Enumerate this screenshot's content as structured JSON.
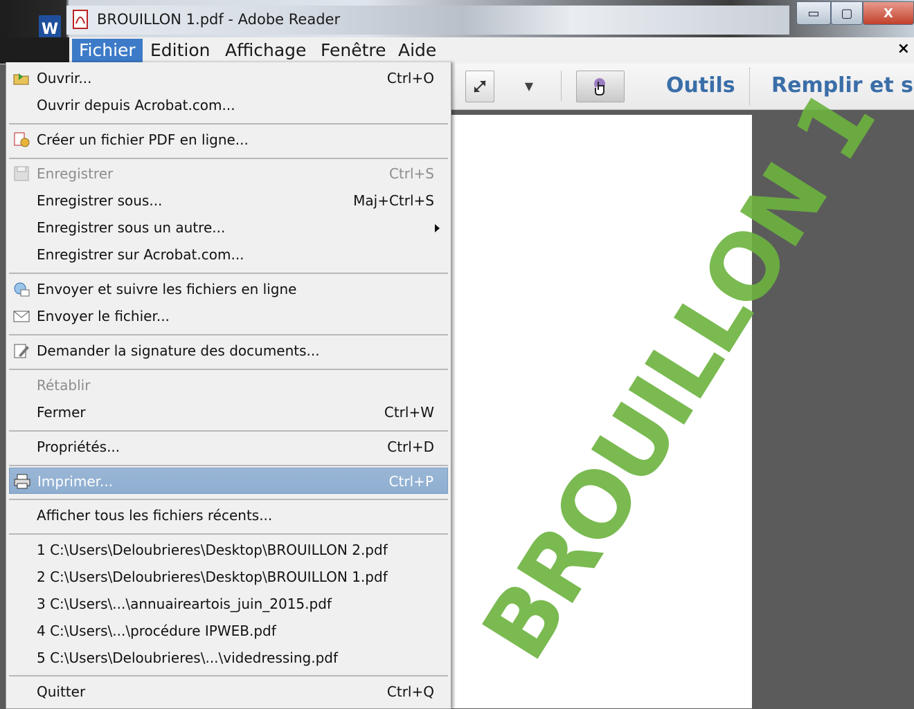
{
  "window": {
    "title": "BROUILLON 1.pdf - Adobe Reader",
    "app_icon_letter": "W",
    "buttons": {
      "minimize": "▭",
      "maximize": "▢",
      "close": "X"
    }
  },
  "menubar": {
    "items": [
      "Fichier",
      "Edition",
      "Affichage",
      "Fenêtre",
      "Aide"
    ],
    "active": "Fichier",
    "close_glyph": "×"
  },
  "toolbar": {
    "outils_label": "Outils",
    "remplir_label": "Remplir et sig",
    "dropdown_glyph": "▼",
    "accent_color": "#3a6ea8"
  },
  "document": {
    "watermark_text": "BROUILLON 1",
    "watermark_color": "#6cb33f"
  },
  "file_menu": {
    "items": [
      {
        "label": "Ouvrir...",
        "shortcut": "Ctrl+O",
        "icon": "open-folder-icon"
      },
      {
        "label": "Ouvrir depuis Acrobat.com...",
        "shortcut": ""
      },
      {
        "label": "Créer un fichier PDF en ligne...",
        "shortcut": "",
        "icon": "create-pdf-icon"
      },
      {
        "label": "Enregistrer",
        "shortcut": "Ctrl+S",
        "icon": "save-icon",
        "disabled": true
      },
      {
        "label": "Enregistrer sous...",
        "shortcut": "Maj+Ctrl+S"
      },
      {
        "label": "Enregistrer sous un autre...",
        "shortcut": "",
        "submenu": true
      },
      {
        "label": "Enregistrer sur Acrobat.com...",
        "shortcut": ""
      },
      {
        "label": "Envoyer et suivre les fichiers en ligne",
        "shortcut": "",
        "icon": "send-track-icon"
      },
      {
        "label": "Envoyer le fichier...",
        "shortcut": "",
        "icon": "mail-icon"
      },
      {
        "label": "Demander la signature des documents...",
        "shortcut": "",
        "icon": "signature-icon"
      },
      {
        "label": "Rétablir",
        "shortcut": "",
        "disabled": true
      },
      {
        "label": "Fermer",
        "shortcut": "Ctrl+W"
      },
      {
        "label": "Propriétés...",
        "shortcut": "Ctrl+D"
      },
      {
        "label": "Imprimer...",
        "shortcut": "Ctrl+P",
        "icon": "printer-icon",
        "highlighted": true
      },
      {
        "label": "Afficher tous les fichiers récents...",
        "shortcut": ""
      },
      {
        "label": "1 C:\\Users\\Deloubrieres\\Desktop\\BROUILLON 2.pdf",
        "shortcut": ""
      },
      {
        "label": "2 C:\\Users\\Deloubrieres\\Desktop\\BROUILLON 1.pdf",
        "shortcut": ""
      },
      {
        "label": "3 C:\\Users\\...\\annuaireartois_juin_2015.pdf",
        "shortcut": ""
      },
      {
        "label": "4 C:\\Users\\...\\procédure IPWEB.pdf",
        "shortcut": ""
      },
      {
        "label": "5 C:\\Users\\Deloubrieres\\...\\videdressing.pdf",
        "shortcut": ""
      },
      {
        "label": "Quitter",
        "shortcut": "Ctrl+Q"
      }
    ]
  }
}
